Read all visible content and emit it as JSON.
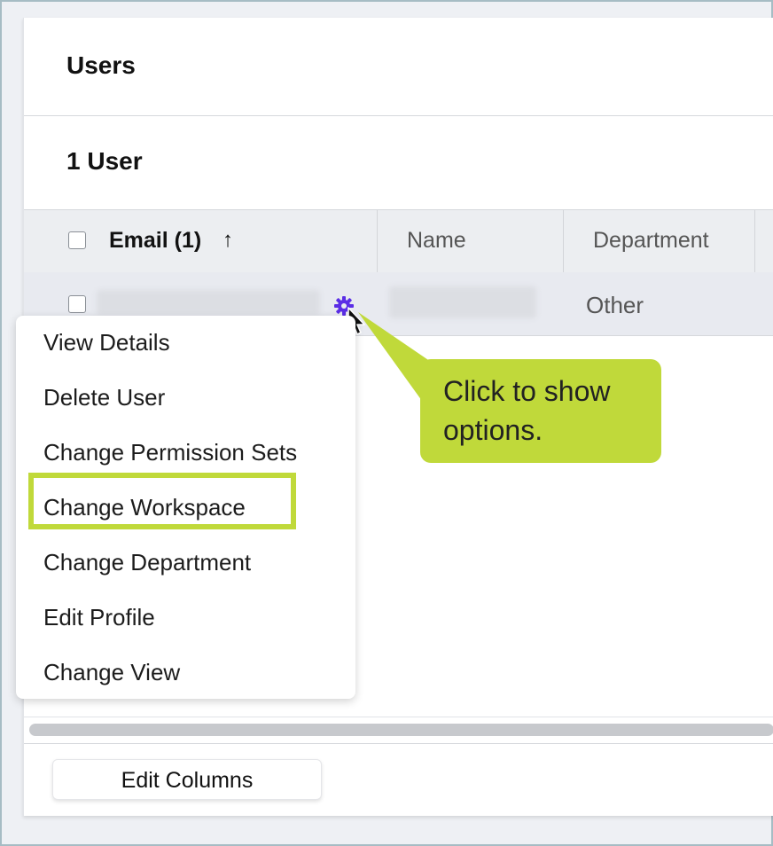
{
  "page": {
    "title": "Users",
    "user_count": "1 User"
  },
  "table": {
    "columns": {
      "email": "Email (1)",
      "sort_arrow": "↑",
      "name": "Name",
      "department": "Department"
    },
    "rows": [
      {
        "department": "Other"
      }
    ]
  },
  "row_menu": {
    "items": [
      "View Details",
      "Delete User",
      "Change Permission Sets",
      "Change Workspace",
      "Change Department",
      "Edit Profile",
      "Change View"
    ],
    "highlighted": "Change Workspace"
  },
  "callout": {
    "text": "Click to show options."
  },
  "footer": {
    "edit_columns_label": "Edit Columns"
  },
  "colors": {
    "accent_gear": "#5b2ee6",
    "callout_green": "#c0d93a"
  },
  "icons": {
    "row_action": "gear-icon",
    "cursor": "mouse-pointer-icon"
  }
}
